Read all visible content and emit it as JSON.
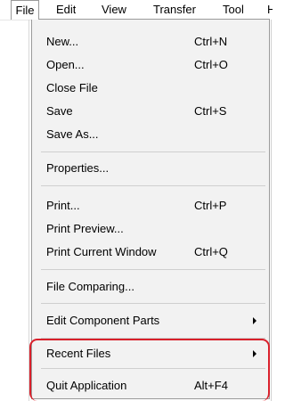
{
  "menubar": {
    "items": [
      {
        "label": "File"
      },
      {
        "label": "Edit"
      },
      {
        "label": "View"
      },
      {
        "label": "Transfer"
      },
      {
        "label": "Tool"
      },
      {
        "label": "H"
      }
    ]
  },
  "file_menu": {
    "items": [
      {
        "label": "New...",
        "shortcut": "Ctrl+N"
      },
      {
        "label": "Open...",
        "shortcut": "Ctrl+O"
      },
      {
        "label": "Close File",
        "shortcut": ""
      },
      {
        "label": "Save",
        "shortcut": "Ctrl+S"
      },
      {
        "label": "Save As...",
        "shortcut": ""
      },
      {
        "label": "Properties...",
        "shortcut": ""
      },
      {
        "label": "Print...",
        "shortcut": "Ctrl+P"
      },
      {
        "label": "Print Preview...",
        "shortcut": ""
      },
      {
        "label": "Print Current Window",
        "shortcut": "Ctrl+Q"
      },
      {
        "label": "File Comparing...",
        "shortcut": ""
      },
      {
        "label": "Edit Component Parts",
        "shortcut": ""
      },
      {
        "label": "Recent Files",
        "shortcut": ""
      },
      {
        "label": "Quit Application",
        "shortcut": "Alt+F4"
      }
    ]
  },
  "colors": {
    "menu_background": "#f2f2f2",
    "highlight_annotation": "#d9202b"
  }
}
